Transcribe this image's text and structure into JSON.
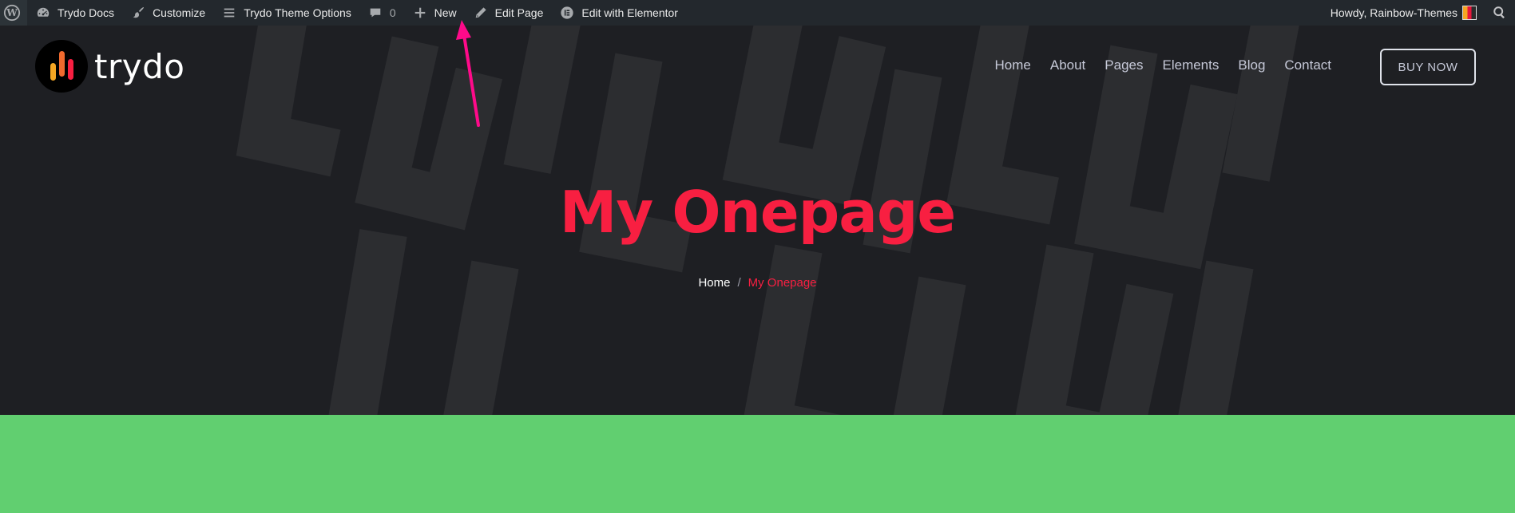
{
  "adminbar": {
    "wp_icon": "wordpress-logo-icon",
    "items": [
      {
        "label": "Trydo Docs",
        "icon": "dashboard-icon"
      },
      {
        "label": "Customize",
        "icon": "brush-icon"
      },
      {
        "label": "Trydo Theme Options",
        "icon": "menu-icon"
      },
      {
        "label": "0",
        "icon": "comment-icon"
      },
      {
        "label": "New",
        "icon": "plus-icon"
      },
      {
        "label": "Edit Page",
        "icon": "pencil-icon"
      },
      {
        "label": "Edit with Elementor",
        "icon": "elementor-icon"
      }
    ],
    "greeting": "Howdy, Rainbow-Themes",
    "search_icon": "search-icon"
  },
  "site": {
    "logo_text": "trydo",
    "logo_bar_colors": [
      "#f5a623",
      "#f06a2e",
      "#f81f41"
    ],
    "nav": [
      "Home",
      "About",
      "Pages",
      "Elements",
      "Blog",
      "Contact"
    ],
    "cta": "BUY NOW"
  },
  "hero": {
    "title": "My Onepage",
    "breadcrumb": {
      "home": "Home",
      "separator": "/",
      "current": "My Onepage"
    }
  },
  "colors": {
    "accent": "#f81f41",
    "adminbar_bg": "#23282d",
    "hero_bg": "#1e1f23",
    "band_green": "#61cf70",
    "annotation_arrow": "#ff0a8a"
  }
}
